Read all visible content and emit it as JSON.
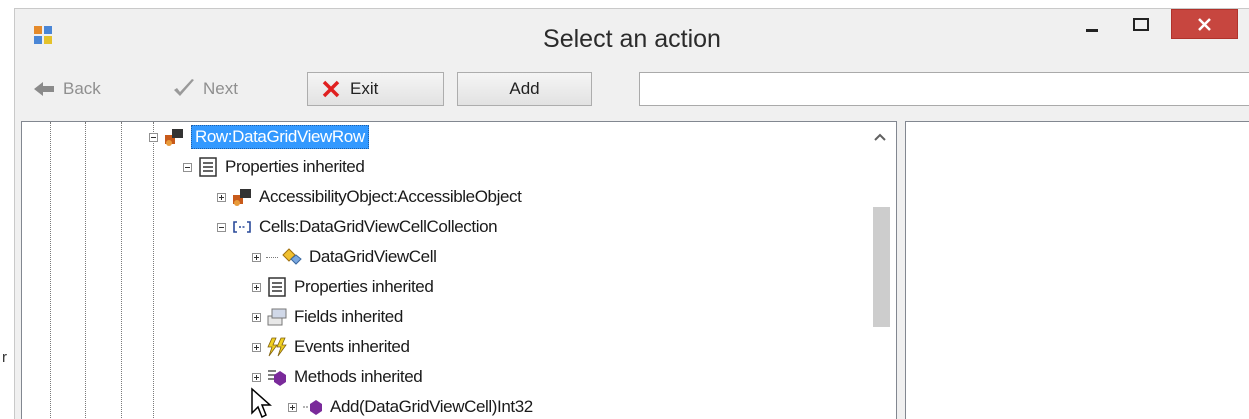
{
  "window": {
    "title": "Select an action",
    "accent_close": "#c7463f",
    "selection_color": "#3399ff"
  },
  "toolbar": {
    "back_label": "Back",
    "next_label": "Next",
    "exit_label": "Exit",
    "add_label": "Add",
    "search_value": ""
  },
  "tree": {
    "nodes": [
      {
        "label": "Row:DataGridViewRow",
        "icon": "object-icon",
        "selected": true
      },
      {
        "label": "Properties inherited",
        "icon": "properties-icon"
      },
      {
        "label": "AccessibilityObject:AccessibleObject",
        "icon": "object-icon"
      },
      {
        "label": "Cells:DataGridViewCellCollection",
        "icon": "collection-icon"
      },
      {
        "label": "DataGridViewCell",
        "icon": "class-icon"
      },
      {
        "label": "Properties inherited",
        "icon": "properties-icon"
      },
      {
        "label": "Fields inherited",
        "icon": "fields-icon"
      },
      {
        "label": "Events inherited",
        "icon": "events-icon"
      },
      {
        "label": "Methods inherited",
        "icon": "methods-icon"
      },
      {
        "label": "Add(DataGridViewCell)Int32",
        "icon": "method-icon"
      }
    ]
  },
  "stray_glyph": "r"
}
